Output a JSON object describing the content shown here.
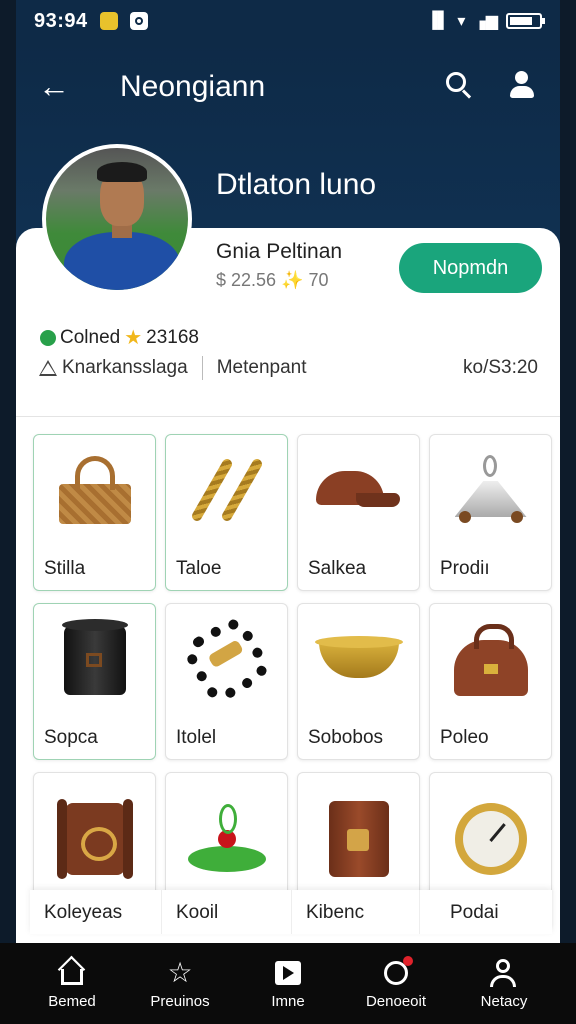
{
  "status_bar": {
    "time": "93:94",
    "signal": "▐▌"
  },
  "header": {
    "title": "Neongiann",
    "name": "Dtlaton luno"
  },
  "profile": {
    "name": "Gnia Peltinan",
    "stats": "$ 22.56 ✨ 70",
    "action_button": "Nopmdn",
    "colned": "Colned",
    "score": "23168",
    "location": "Knarkansslaga",
    "middle": "Metenpant",
    "right": "ko/S3:20"
  },
  "colors": {
    "accent": "#1aa57c",
    "header_bg": "#0e2a47"
  },
  "items": [
    {
      "label": "Stilla",
      "icon": "basket-icon",
      "selected": true
    },
    {
      "label": "Taloe",
      "icon": "rope-icon",
      "selected": true
    },
    {
      "label": "Salkea",
      "icon": "cap-icon",
      "selected": false
    },
    {
      "label": "Prodiı",
      "icon": "bell-cart-icon",
      "selected": false
    },
    {
      "label": "Sopca",
      "icon": "pot-icon",
      "selected": true
    },
    {
      "label": "Itolel",
      "icon": "bead-bracelet-icon",
      "selected": false
    },
    {
      "label": "Sobobos",
      "icon": "bowl-icon",
      "selected": false
    },
    {
      "label": "Poleo",
      "icon": "bag-icon",
      "selected": false
    },
    {
      "label": "Koleyeas",
      "icon": "scroll-box-icon",
      "selected": false
    },
    {
      "label": "Kooil",
      "icon": "spinning-top-icon",
      "selected": false
    },
    {
      "label": "Kibenc",
      "icon": "barrel-icon",
      "selected": false
    },
    {
      "label": "Podai",
      "icon": "clock-icon",
      "selected": false
    }
  ],
  "nav": [
    {
      "label": "Bemed",
      "icon": "home-icon"
    },
    {
      "label": "Preuinos",
      "icon": "star-icon"
    },
    {
      "label": "Imne",
      "icon": "play-icon"
    },
    {
      "label": "Denoeoit",
      "icon": "bell-icon"
    },
    {
      "label": "Netacy",
      "icon": "person-icon"
    }
  ]
}
